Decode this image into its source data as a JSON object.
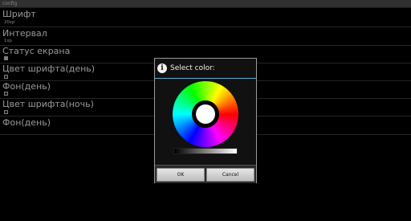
{
  "window": {
    "title": "config"
  },
  "settings": [
    {
      "title": "Шрифт",
      "summary": "20sp",
      "control": "text"
    },
    {
      "title": "Интервал",
      "summary": "1sp",
      "control": "text"
    },
    {
      "title": "Статус екрана",
      "control": "checkbox",
      "checked": true
    },
    {
      "title": "Цвет шрифта(день)",
      "control": "checkbox",
      "checked": false
    },
    {
      "title": "Фон(день)",
      "control": "checkbox",
      "checked": false
    },
    {
      "title": "Цвет шрифта(ночь)",
      "control": "checkbox",
      "checked": false
    },
    {
      "title": "Фон(день)",
      "control": "none"
    }
  ],
  "dialog": {
    "title": "Select color:",
    "icon": "info-icon",
    "selected_color": "#ffffff",
    "buttons": {
      "ok": "OK",
      "cancel": "Cancel"
    }
  },
  "colors": {
    "background": "#000000",
    "dialog_border": "#9a9a9a",
    "header_accent": "#5aaed8"
  }
}
